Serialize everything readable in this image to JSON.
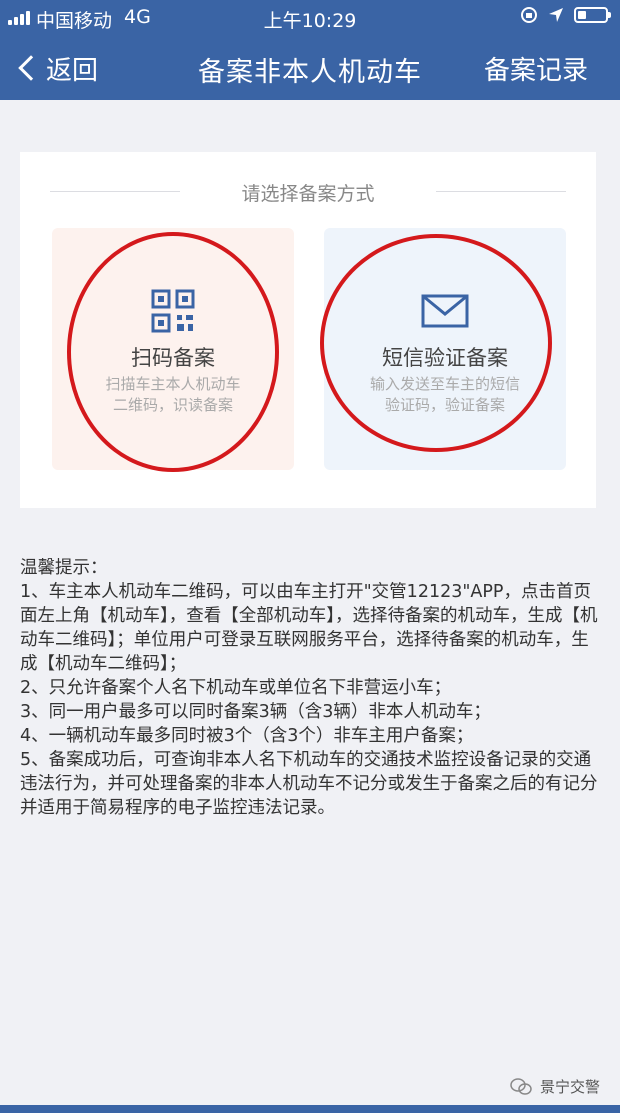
{
  "status": {
    "carrier": "中国移动",
    "network": "4G",
    "time": "上午10:29"
  },
  "nav": {
    "back_label": "返回",
    "title": "备案非本人机动车",
    "right_action": "备案记录"
  },
  "card": {
    "header": "请选择备案方式",
    "options": [
      {
        "title": "扫码备案",
        "desc_line1": "扫描车主本人机动车",
        "desc_line2": "二维码，识读备案",
        "icon": "qr-code-icon"
      },
      {
        "title": "短信验证备案",
        "desc_line1": "输入发送至车主的短信",
        "desc_line2": "验证码，验证备案",
        "icon": "envelope-icon"
      }
    ]
  },
  "tips": {
    "heading": "温馨提示：",
    "items": [
      "1、车主本人机动车二维码，可以由车主打开\"交管12123\"APP，点击首页面左上角【机动车】，查看【全部机动车】，选择待备案的机动车，生成【机动车二维码】；单位用户可登录互联网服务平台，选择待备案的机动车，生成【机动车二维码】；",
      "2、只允许备案个人名下机动车或单位名下非营运小车；",
      "3、同一用户最多可以同时备案3辆（含3辆）非本人机动车；",
      "4、一辆机动车最多同时被3个（含3个）非车主用户备案；",
      "5、备案成功后，可查询非本人名下机动车的交通技术监控设备记录的交通违法行为，并可处理备案的非本人机动车不记分或发生于备案之后的有记分并适用于简易程序的电子监控违法记录。"
    ]
  },
  "watermark": {
    "text": "景宁交警"
  },
  "colors": {
    "nav_bg": "#3a64a5",
    "annotation_ring": "#d4191c",
    "scan_bg": "#fdf2ee",
    "sms_bg": "#eef4fb"
  }
}
